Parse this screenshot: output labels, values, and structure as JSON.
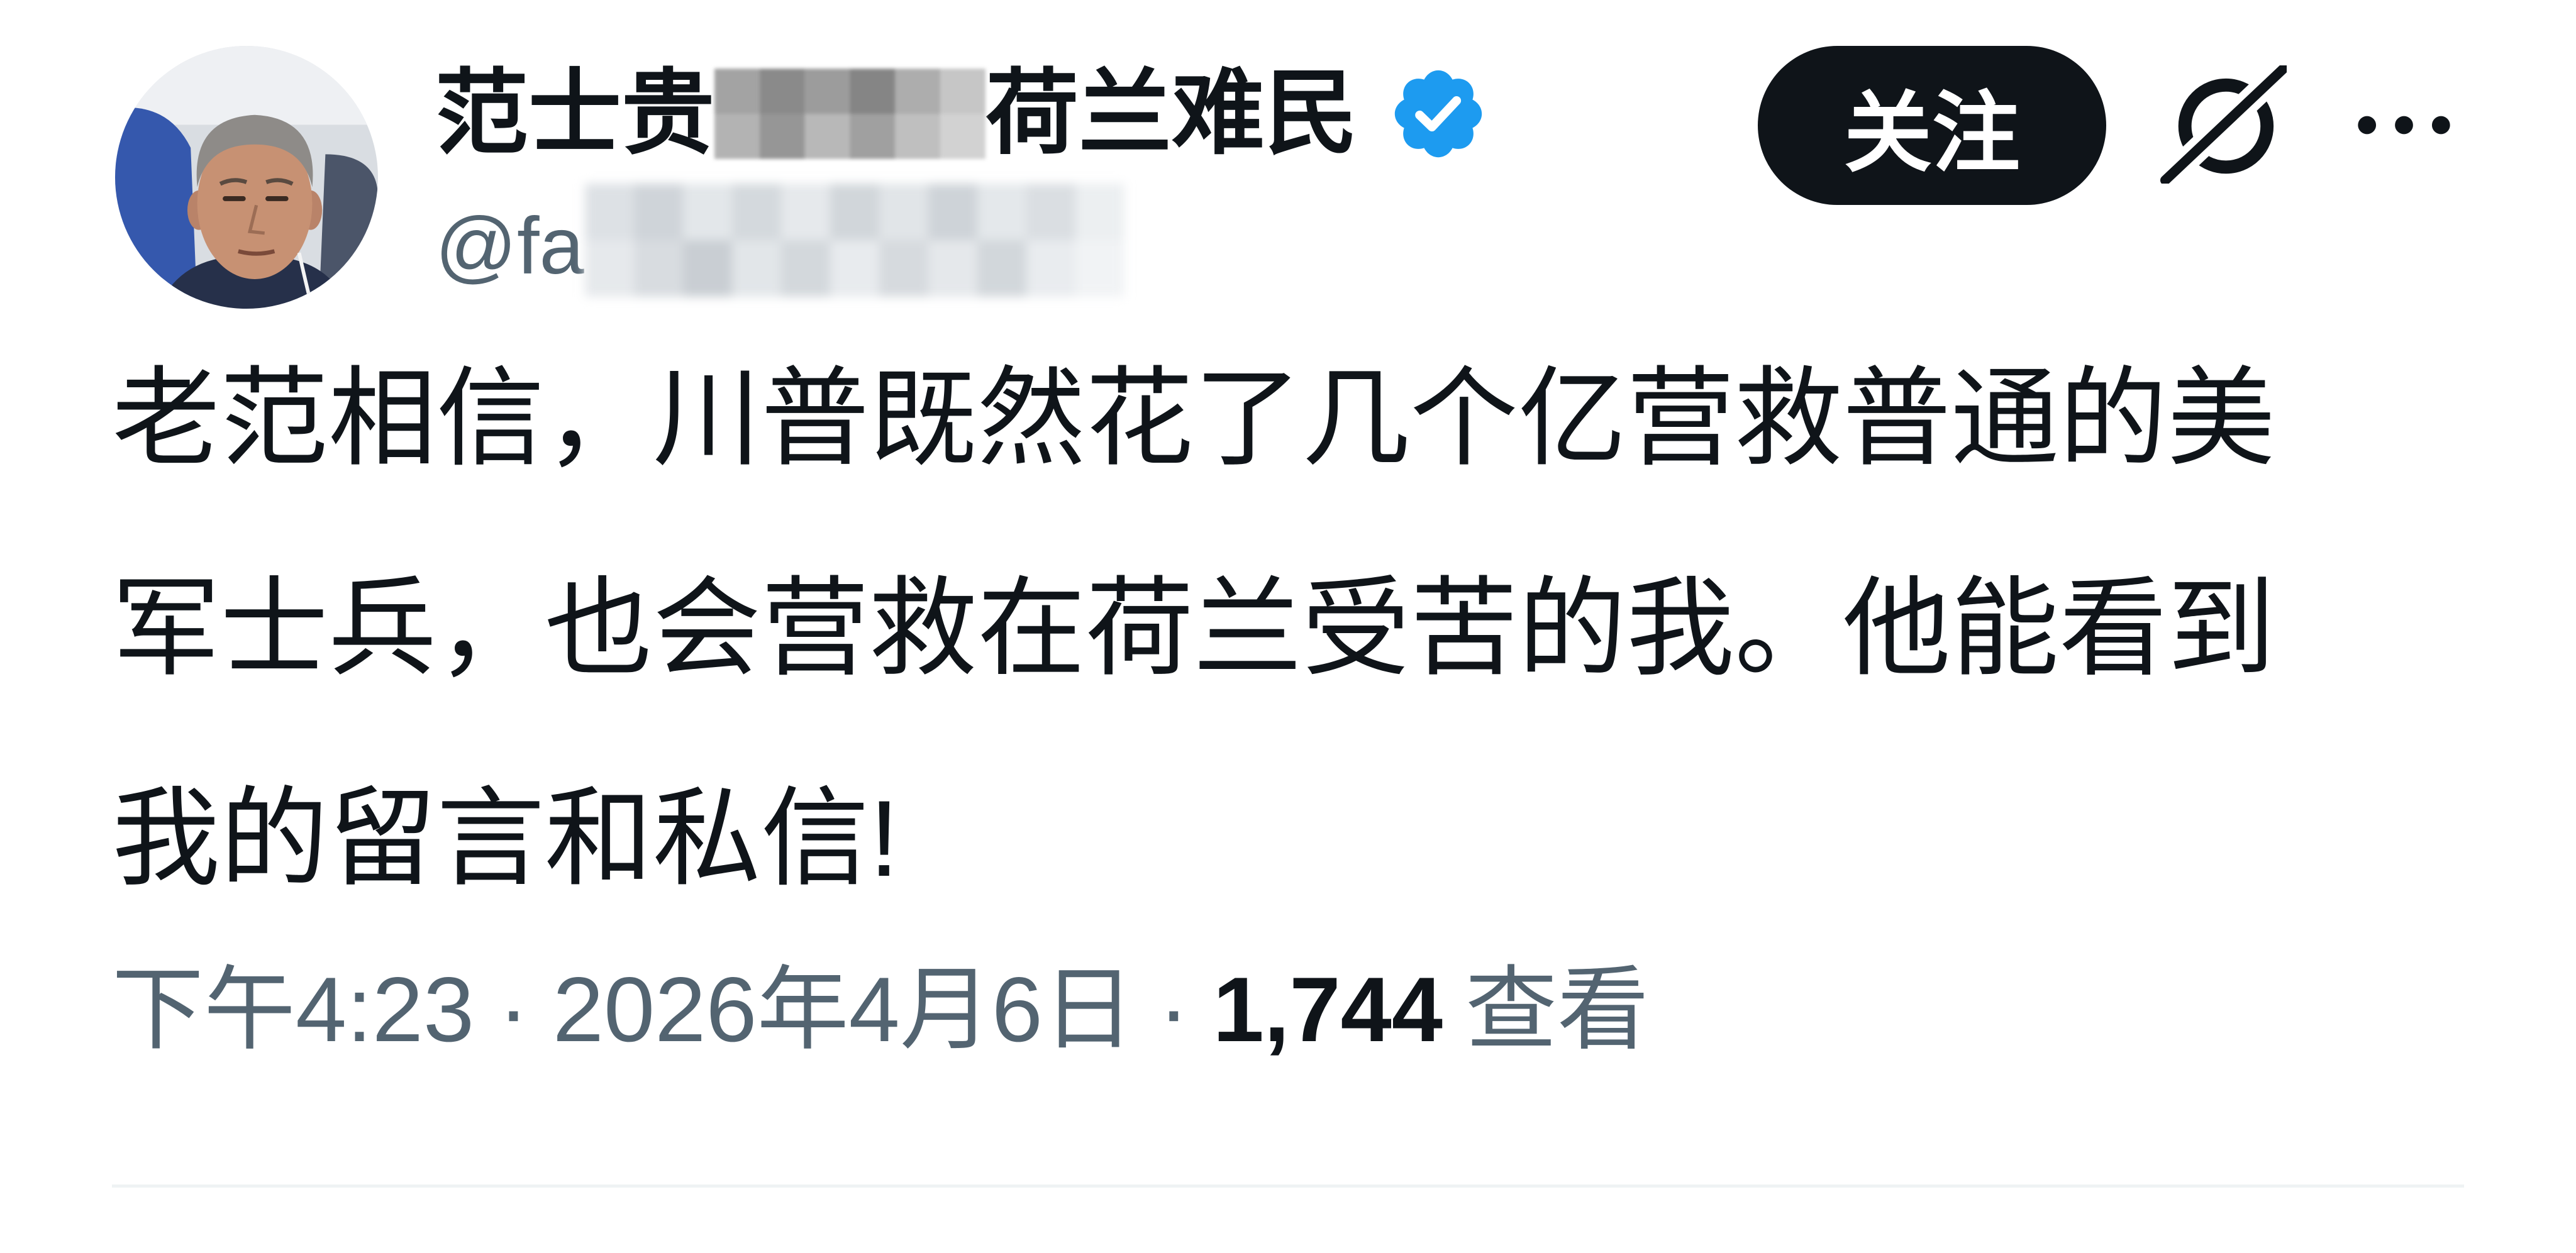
{
  "author": {
    "name_start": "范士贵",
    "name_end": "荷兰难民",
    "handle_visible": "@fa",
    "verified": true
  },
  "follow_button": {
    "label": "关注"
  },
  "icons": {
    "avatar": "profile-photo",
    "verified": "verified-badge-icon",
    "grok": "grok-icon",
    "more": "more-options-icon"
  },
  "tweet": {
    "lines": [
      "老范相信，川普既然花了几个亿营救普通的美",
      "军士兵，也会营救在荷兰受苦的我。他能看到",
      "我的留言和私信!"
    ]
  },
  "meta": {
    "time": "下午4:23",
    "separator": "·",
    "date": "2026年4月6日",
    "views_count": "1,744",
    "views_label": "查看"
  },
  "colors": {
    "text": "#0f1419",
    "secondary": "#536471",
    "verified": "#1d9bf0",
    "follow_bg": "#0f1419",
    "follow_text": "#ffffff",
    "divider": "#eff3f4"
  }
}
